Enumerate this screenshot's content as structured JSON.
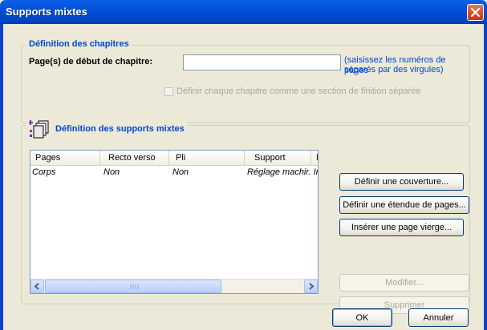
{
  "window": {
    "title": "Supports mixtes"
  },
  "chapters": {
    "legend": "Définition des chapitres",
    "start_label": "Page(s) de début de chapitre:",
    "start_value": "",
    "hint_line1": "(saisissez les numéros de pages",
    "hint_line2": "séparés par des virgules)",
    "section_checkbox_label": "Définir chaque chapitre comme une section de finition séparée",
    "section_checkbox_checked": false
  },
  "mixed": {
    "legend": "Définition des supports mixtes",
    "columns": [
      "Pages",
      "Recto verso",
      "Pli",
      "Support",
      "M"
    ],
    "rows": [
      [
        "Corps",
        "Non",
        "Non",
        "Réglage machir. Ir",
        ""
      ]
    ],
    "buttons": {
      "cover": "Définir une couverture...",
      "range": "Définir une étendue de pages...",
      "blank": "Insérer une page vierge...",
      "modify": "Modifier...",
      "delete": "Supprimer"
    }
  },
  "footer": {
    "ok": "OK",
    "cancel": "Annuler"
  },
  "colors": {
    "accent": "#0046d5",
    "titlebar": "#0350d9",
    "close": "#d54b28"
  },
  "icons": {
    "close": "close-icon",
    "mixed_media": "stacked-pages-icon",
    "scroll_left": "arrow-left-icon",
    "scroll_right": "arrow-right-icon"
  }
}
